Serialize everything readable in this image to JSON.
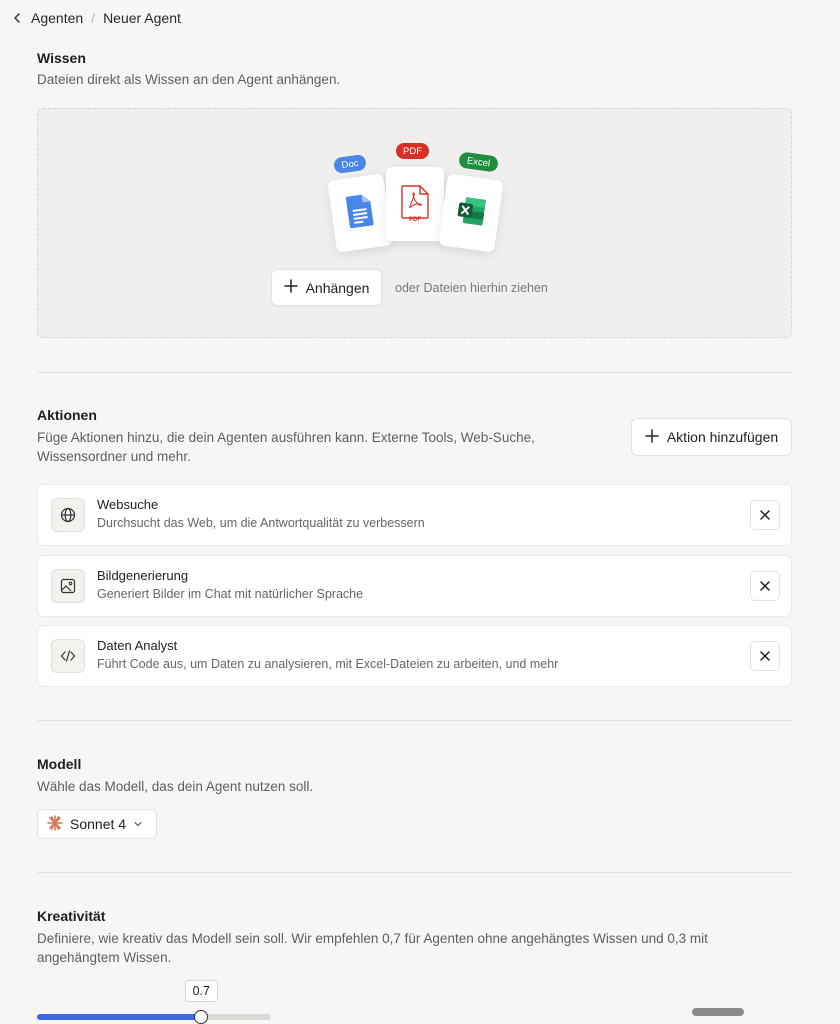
{
  "breadcrumb": {
    "parent": "Agenten",
    "separator": "/",
    "current": "Neuer Agent"
  },
  "knowledge": {
    "title": "Wissen",
    "subtitle": "Dateien direkt als Wissen an den Agent anhängen.",
    "tags": {
      "doc": "Doc",
      "pdf": "PDF",
      "excel": "Excel"
    },
    "pdf_card_label": "PDF",
    "attach_label": "Anhängen",
    "drop_hint": "oder Dateien hierhin ziehen",
    "colors": {
      "doc": "#4a86e8",
      "pdf": "#d93025",
      "excel": "#1e8e3e"
    }
  },
  "actions": {
    "title": "Aktionen",
    "subtitle_line1": "Füge Aktionen hinzu, die dein Agenten ausführen kann. Externe Tools, Web-Suche,",
    "subtitle_line2": "Wissensordner und mehr.",
    "add_label": "Aktion hinzufügen",
    "items": [
      {
        "icon": "globe-icon",
        "title": "Websuche",
        "description": "Durchsucht das Web, um die Antwortqualität zu verbessern"
      },
      {
        "icon": "image-icon",
        "title": "Bildgenerierung",
        "description": "Generiert Bilder im Chat mit natürlicher Sprache"
      },
      {
        "icon": "code-icon",
        "title": "Daten Analyst",
        "description": "Führt Code aus, um Daten zu analysieren, mit Excel-Dateien zu arbeiten, und mehr"
      }
    ]
  },
  "model": {
    "title": "Modell",
    "subtitle": "Wähle das Modell, das dein Agent nutzen soll.",
    "selected": "Sonnet 4",
    "brand_color": "#d97757"
  },
  "creativity": {
    "title": "Kreativität",
    "subtitle_line1": "Definiere, wie kreativ das Modell sein soll. Wir empfehlen 0,7 für Agenten ohne angehängtes Wissen und 0,3 mit",
    "subtitle_line2": "angehängtem Wissen.",
    "value": 0.7,
    "value_label": "0.7",
    "accent": "#3b6ae8"
  }
}
